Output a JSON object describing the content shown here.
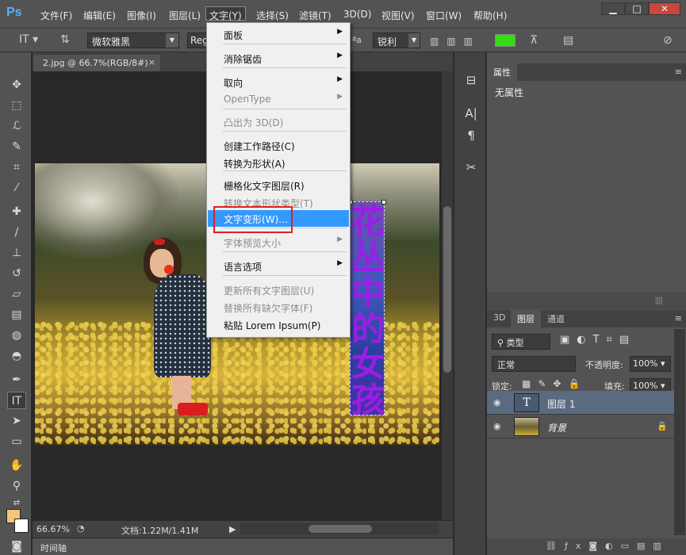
{
  "app": {
    "logo": "Ps"
  },
  "menu": {
    "items": [
      "文件(F)",
      "编辑(E)",
      "图像(I)",
      "图层(L)",
      "文字(Y)",
      "选择(S)",
      "滤镜(T)",
      "3D(D)",
      "视图(V)",
      "窗口(W)",
      "帮助(H)"
    ],
    "active_index": 4
  },
  "window_controls": {
    "minimize": "▁",
    "maximize": "□",
    "close": "✕"
  },
  "options_bar": {
    "font_family": "微软雅黑",
    "font_style": "Regular",
    "antialias": "锐利",
    "text_color": "#33dd11"
  },
  "document": {
    "tab_title": "2.jpg @ 66.7%(RGB/8#)",
    "tab_close": "×",
    "vertical_text": "花丛中的女孩"
  },
  "status_bar": {
    "zoom": "66.67%",
    "doc_info": "文档:1.22M/1.41M"
  },
  "timeline": {
    "label": "时间轴"
  },
  "dropdown": {
    "items": [
      {
        "label": "面板",
        "submenu": true,
        "disabled": false
      },
      {
        "label": "消除锯齿",
        "submenu": true,
        "disabled": false
      },
      {
        "label": "取向",
        "submenu": true,
        "disabled": false
      },
      {
        "label": "OpenType",
        "submenu": true,
        "disabled": true
      },
      {
        "label": "凸出为 3D(D)",
        "submenu": false,
        "disabled": true
      },
      {
        "label": "创建工作路径(C)",
        "submenu": false,
        "disabled": false
      },
      {
        "label": "转换为形状(A)",
        "submenu": false,
        "disabled": false
      },
      {
        "label": "栅格化文字图层(R)",
        "submenu": false,
        "disabled": false
      },
      {
        "label": "转换文本形状类型(T)",
        "submenu": false,
        "disabled": true
      },
      {
        "label": "文字变形(W)...",
        "submenu": false,
        "disabled": false,
        "highlighted": true
      },
      {
        "label": "字体预览大小",
        "submenu": true,
        "disabled": true
      },
      {
        "label": "语言选项",
        "submenu": true,
        "disabled": false
      },
      {
        "label": "更新所有文字图层(U)",
        "submenu": false,
        "disabled": true
      },
      {
        "label": "替换所有缺欠字体(F)",
        "submenu": false,
        "disabled": true
      },
      {
        "label": "粘贴 Lorem Ipsum(P)",
        "submenu": false,
        "disabled": false
      }
    ]
  },
  "properties_panel": {
    "tab": "属性",
    "content": "无属性"
  },
  "layers_panel": {
    "tabs": [
      "3D",
      "图层",
      "通道"
    ],
    "active_tab": 1,
    "filter_label": "类型",
    "blend_mode": "正常",
    "opacity_label": "不透明度:",
    "opacity_value": "100%",
    "lock_label": "锁定:",
    "fill_label": "填充:",
    "fill_value": "100%",
    "layers": [
      {
        "name": "图层 1",
        "type": "text",
        "thumb": "T",
        "selected": true
      },
      {
        "name": "背景",
        "type": "photo",
        "selected": false,
        "locked": true
      }
    ]
  },
  "colors": {
    "foreground": "#f5c57a",
    "background": "#ffffff",
    "highlight": "#3399ff",
    "annotation_box": "#e02020"
  }
}
